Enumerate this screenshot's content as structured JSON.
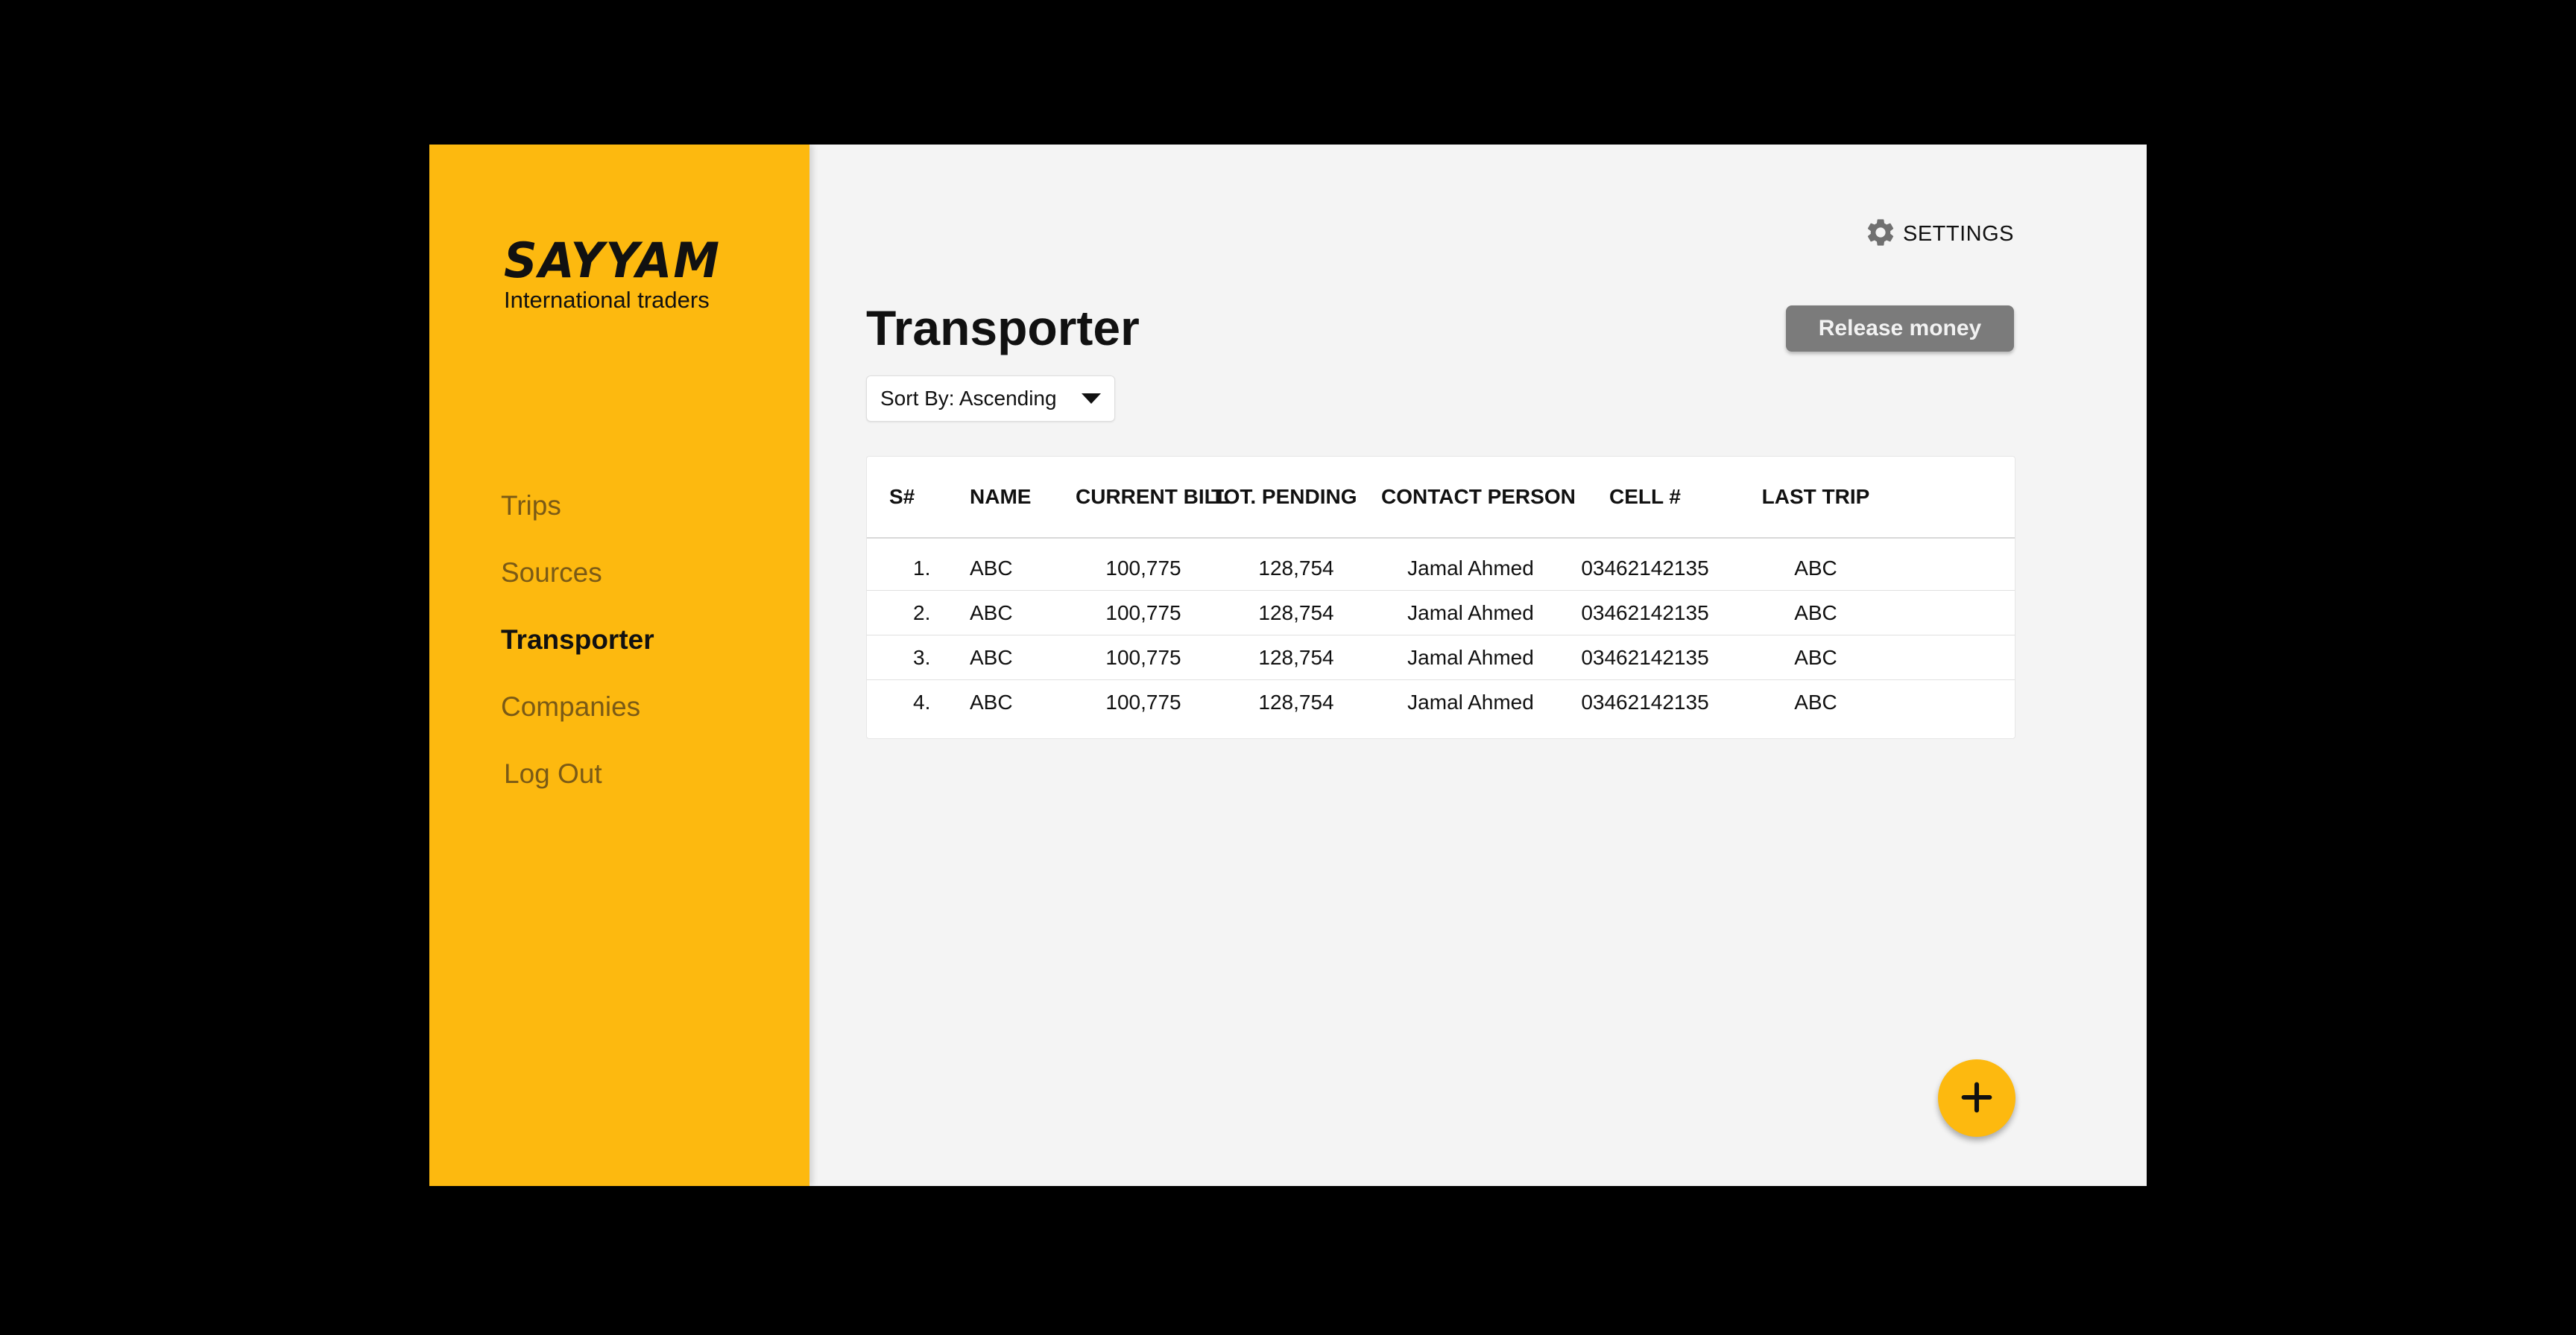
{
  "brand": {
    "name": "SAYYAM",
    "tagline": "International traders"
  },
  "sidebar": {
    "items": [
      {
        "label": "Trips",
        "active": false
      },
      {
        "label": "Sources",
        "active": false
      },
      {
        "label": "Transporter",
        "active": true
      },
      {
        "label": "Companies",
        "active": false
      },
      {
        "label": "Log Out",
        "active": false
      }
    ]
  },
  "header": {
    "settings_label": "SETTINGS",
    "settings_icon": "gear-icon",
    "title": "Transporter",
    "release_button": "Release money",
    "sort_label": "Sort By: Ascending",
    "sort_icon": "chevron-down-icon"
  },
  "table": {
    "columns": [
      "S#",
      "NAME",
      "CURRENT BILL",
      "TOT. PENDING",
      "CONTACT PERSON",
      "CELL #",
      "LAST TRIP"
    ],
    "rows": [
      [
        "1.",
        "ABC",
        "100,775",
        "128,754",
        "Jamal Ahmed",
        "03462142135",
        "ABC"
      ],
      [
        "2.",
        "ABC",
        "100,775",
        "128,754",
        "Jamal Ahmed",
        "03462142135",
        "ABC"
      ],
      [
        "3.",
        "ABC",
        "100,775",
        "128,754",
        "Jamal Ahmed",
        "03462142135",
        "ABC"
      ],
      [
        "4.",
        "ABC",
        "100,775",
        "128,754",
        "Jamal Ahmed",
        "03462142135",
        "ABC"
      ]
    ]
  },
  "fab": {
    "icon": "plus-icon"
  },
  "colors": {
    "accent": "#fdb90f",
    "button_gray": "#7b7b7b",
    "content_bg": "#f4f4f4",
    "frame": "#000000"
  }
}
